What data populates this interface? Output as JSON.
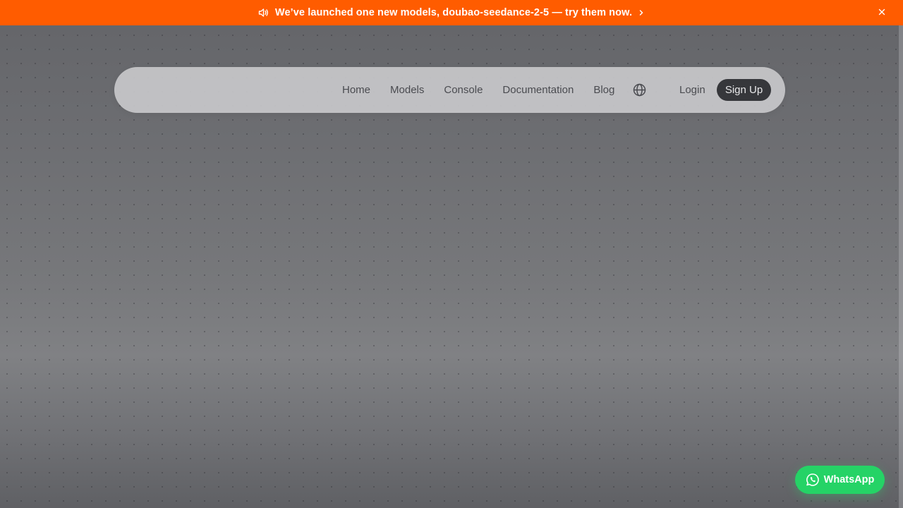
{
  "announcement": {
    "text": "We’ve launched one new models, doubao-seedance-2-5 — try them now.",
    "icons": {
      "leading": "speaker-icon",
      "trailing": "chevron-right-icon",
      "close": "close-icon"
    },
    "background_color": "#ff5c00"
  },
  "navbar": {
    "links": [
      {
        "label": "Home"
      },
      {
        "label": "Models"
      },
      {
        "label": "Console"
      },
      {
        "label": "Documentation"
      },
      {
        "label": "Blog"
      }
    ],
    "language_icon": "globe-icon",
    "login_label": "Login",
    "signup_label": "Sign Up"
  },
  "whatsapp": {
    "label": "WhatsApp",
    "icon": "whatsapp-icon",
    "color": "#25d366"
  }
}
